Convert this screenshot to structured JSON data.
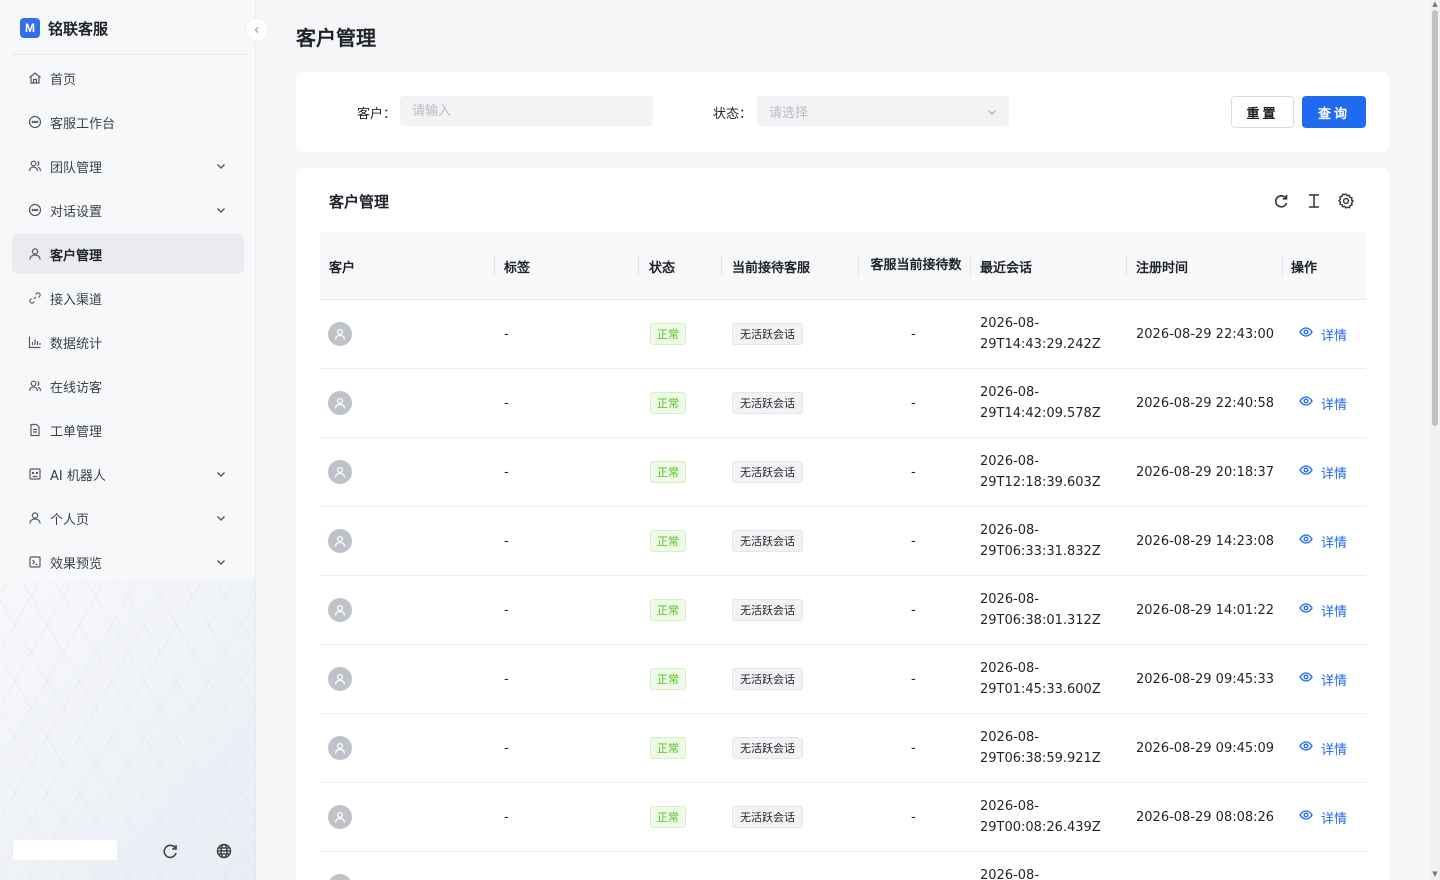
{
  "brand": {
    "logo_text": "M",
    "name": "铭联客服"
  },
  "sidebar": {
    "items": [
      {
        "label": "首页",
        "icon": "home-icon",
        "expandable": false,
        "active": false
      },
      {
        "label": "客服工作台",
        "icon": "chat-bubble-icon",
        "expandable": false,
        "active": false
      },
      {
        "label": "团队管理",
        "icon": "team-icon",
        "expandable": true,
        "active": false
      },
      {
        "label": "对话设置",
        "icon": "chat-bubble-icon",
        "expandable": true,
        "active": false
      },
      {
        "label": "客户管理",
        "icon": "user-icon",
        "expandable": false,
        "active": true
      },
      {
        "label": "接入渠道",
        "icon": "link-icon",
        "expandable": false,
        "active": false
      },
      {
        "label": "数据统计",
        "icon": "bar-chart-icon",
        "expandable": false,
        "active": false
      },
      {
        "label": "在线访客",
        "icon": "team-icon",
        "expandable": false,
        "active": false
      },
      {
        "label": "工单管理",
        "icon": "document-icon",
        "expandable": false,
        "active": false
      },
      {
        "label": "AI 机器人",
        "icon": "robot-icon",
        "expandable": true,
        "active": false
      },
      {
        "label": "个人页",
        "icon": "user-icon",
        "expandable": true,
        "active": false
      },
      {
        "label": "效果预览",
        "icon": "preview-icon",
        "expandable": true,
        "active": false
      }
    ]
  },
  "page": {
    "title": "客户管理"
  },
  "filters": {
    "customer_label": "客户：",
    "customer_placeholder": "请输入",
    "status_label": "状态：",
    "status_placeholder": "请选择",
    "reset_label": "重置",
    "query_label": "查询"
  },
  "table": {
    "title": "客户管理",
    "columns": [
      "客户",
      "标签",
      "状态",
      "当前接待客服",
      "客服当前接待数",
      "最近会话",
      "注册时间",
      "操作"
    ],
    "rows": [
      {
        "tag": "-",
        "status": "正常",
        "agent": "无活跃会话",
        "count": "-",
        "recent_date": "2026-08-",
        "recent_time": "29T14:43:29.242Z",
        "registered": "2026-08-29 22:43:00",
        "action": "详情"
      },
      {
        "tag": "-",
        "status": "正常",
        "agent": "无活跃会话",
        "count": "-",
        "recent_date": "2026-08-",
        "recent_time": "29T14:42:09.578Z",
        "registered": "2026-08-29 22:40:58",
        "action": "详情"
      },
      {
        "tag": "-",
        "status": "正常",
        "agent": "无活跃会话",
        "count": "-",
        "recent_date": "2026-08-",
        "recent_time": "29T12:18:39.603Z",
        "registered": "2026-08-29 20:18:37",
        "action": "详情"
      },
      {
        "tag": "-",
        "status": "正常",
        "agent": "无活跃会话",
        "count": "-",
        "recent_date": "2026-08-",
        "recent_time": "29T06:33:31.832Z",
        "registered": "2026-08-29 14:23:08",
        "action": "详情"
      },
      {
        "tag": "-",
        "status": "正常",
        "agent": "无活跃会话",
        "count": "-",
        "recent_date": "2026-08-",
        "recent_time": "29T06:38:01.312Z",
        "registered": "2026-08-29 14:01:22",
        "action": "详情"
      },
      {
        "tag": "-",
        "status": "正常",
        "agent": "无活跃会话",
        "count": "-",
        "recent_date": "2026-08-",
        "recent_time": "29T01:45:33.600Z",
        "registered": "2026-08-29 09:45:33",
        "action": "详情"
      },
      {
        "tag": "-",
        "status": "正常",
        "agent": "无活跃会话",
        "count": "-",
        "recent_date": "2026-08-",
        "recent_time": "29T06:38:59.921Z",
        "registered": "2026-08-29 09:45:09",
        "action": "详情"
      },
      {
        "tag": "-",
        "status": "正常",
        "agent": "无活跃会话",
        "count": "-",
        "recent_date": "2026-08-",
        "recent_time": "29T00:08:26.439Z",
        "registered": "2026-08-29 08:08:26",
        "action": "详情"
      },
      {
        "tag": "",
        "status": "",
        "agent": "",
        "count": "",
        "recent_date": "2026-08-",
        "recent_time": "",
        "registered": "",
        "action": ""
      }
    ]
  },
  "colors": {
    "primary": "#1f6bf0",
    "success": "#52c41a",
    "sidebar_bg": "#f7f8fa"
  }
}
